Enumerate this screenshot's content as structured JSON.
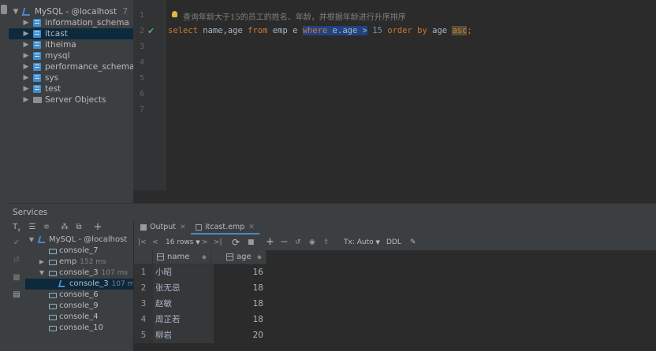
{
  "db_tree": {
    "root": {
      "label": "MySQL - @localhost",
      "badge": "7"
    },
    "items": [
      {
        "label": "information_schema",
        "selected": false
      },
      {
        "label": "itcast",
        "selected": true
      },
      {
        "label": "itheima",
        "selected": false
      },
      {
        "label": "mysql",
        "selected": false
      },
      {
        "label": "performance_schema",
        "selected": false
      },
      {
        "label": "sys",
        "selected": false
      },
      {
        "label": "test",
        "selected": false
      }
    ],
    "server_objects": "Server Objects"
  },
  "editor": {
    "line_numbers": [
      "1",
      "2",
      "3",
      "4",
      "5",
      "6",
      "7"
    ],
    "comment": "查询年龄大于15的员工的姓名、年龄，并根据年龄进行升序排序",
    "sql": {
      "select": "select",
      "cols": "name,age",
      "from": "from",
      "table": "emp e",
      "where": "where",
      "cond": "e.age >",
      "num": "15",
      "order_by": "order by",
      "age": "age",
      "asc": "asc",
      "semi": ";"
    }
  },
  "services": {
    "title": "Services",
    "tree": {
      "root": "MySQL - @localhost",
      "items": [
        {
          "label": "console_7",
          "time": ""
        },
        {
          "label": "emp",
          "time": "152 ms"
        },
        {
          "label": "console_3",
          "time": "107 ms"
        },
        {
          "label": "console_3",
          "time": "107 ms"
        },
        {
          "label": "console_6",
          "time": ""
        },
        {
          "label": "console_9",
          "time": ""
        },
        {
          "label": "console_4",
          "time": ""
        },
        {
          "label": "console_10",
          "time": ""
        }
      ]
    },
    "toolbar_icons": [
      "tx-icon",
      "expand-all-icon",
      "collapse-all-icon",
      "group-icon",
      "filter-icon",
      "add-icon"
    ]
  },
  "results": {
    "tabs": [
      {
        "label": "Output",
        "active": false
      },
      {
        "label": "itcast.emp",
        "active": true
      }
    ],
    "toolbar": {
      "rows": "16 rows",
      "tx": "Tx: Auto",
      "ddl": "DDL"
    },
    "columns": [
      "name",
      "age"
    ],
    "rows": [
      {
        "n": "1",
        "name": "小昭",
        "age": "16"
      },
      {
        "n": "2",
        "name": "张无忌",
        "age": "18"
      },
      {
        "n": "3",
        "name": "赵敏",
        "age": "18"
      },
      {
        "n": "4",
        "name": "周芷若",
        "age": "18"
      },
      {
        "n": "5",
        "name": "柳岩",
        "age": "20"
      }
    ]
  },
  "colors": {
    "accent": "#4a88c7",
    "keyword": "#cc7832",
    "number": "#6897bb",
    "selection": "#214283",
    "check": "#59a869"
  }
}
